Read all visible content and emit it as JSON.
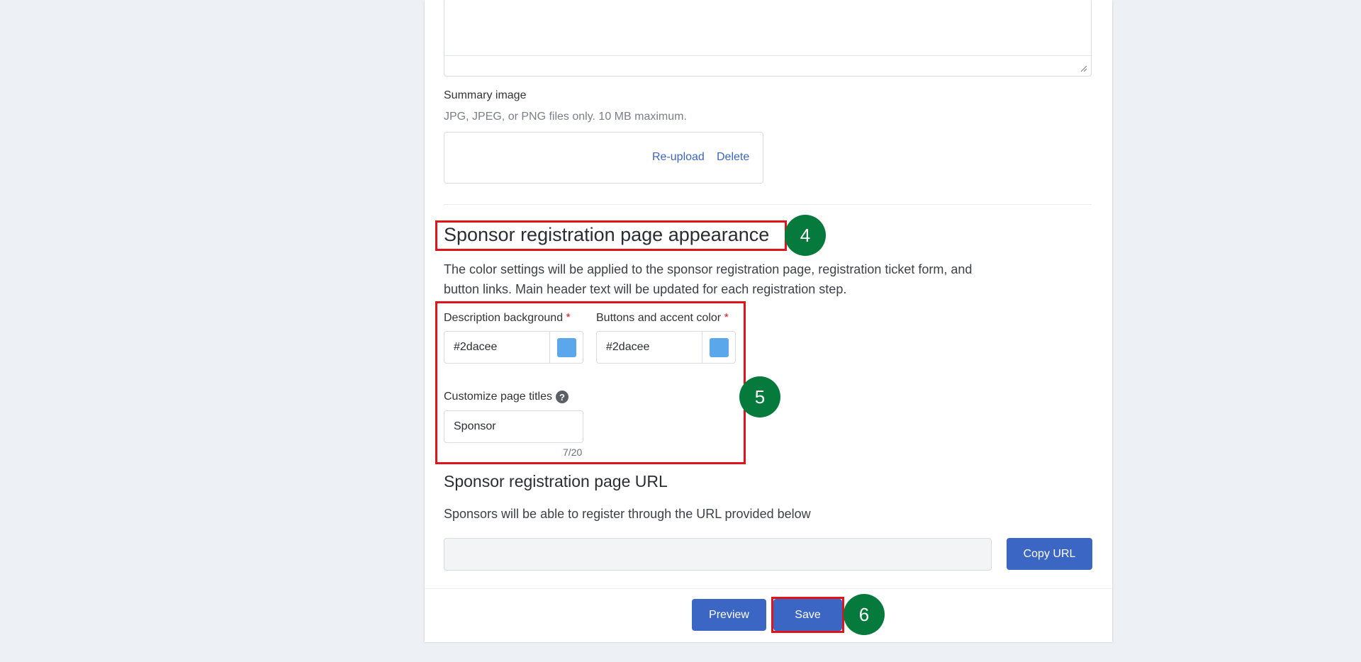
{
  "summary_image": {
    "label": "Summary image",
    "hint": "JPG, JPEG, or PNG files only. 10 MB maximum.",
    "reupload_label": "Re-upload",
    "delete_label": "Delete"
  },
  "appearance": {
    "title": "Sponsor registration page appearance",
    "description": "The color settings will be applied to the sponsor registration page, registration ticket form, and button links. Main header text will be updated for each registration step.",
    "description_background": {
      "label": "Description background",
      "required_mark": "*",
      "value": "#2dacee",
      "swatch_color": "#5aa7ec"
    },
    "accent_color": {
      "label": "Buttons and accent color",
      "required_mark": "*",
      "value": "#2dacee",
      "swatch_color": "#5aa7ec"
    },
    "page_titles": {
      "label": "Customize page titles",
      "help_icon": "?",
      "value": "Sponsor",
      "counter": "7/20"
    }
  },
  "url_section": {
    "title": "Sponsor registration page URL",
    "description": "Sponsors will be able to register through the URL provided below",
    "url_value": "",
    "copy_label": "Copy URL"
  },
  "footer": {
    "preview_label": "Preview",
    "save_label": "Save"
  },
  "badges": {
    "step4": "4",
    "step5": "5",
    "step6": "6"
  },
  "colors": {
    "badge": "#057a3c",
    "highlight": "#e0151b",
    "button": "#3b66c4",
    "link": "#3a66c3"
  }
}
